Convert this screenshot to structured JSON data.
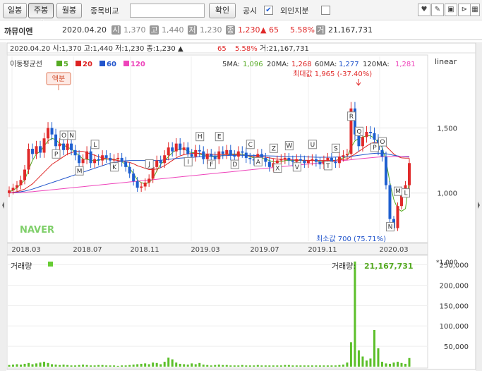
{
  "toolbar": {
    "btn_daily": "일봉",
    "btn_weekly": "주봉",
    "btn_monthly": "월봉",
    "compare_label": "종목비교",
    "confirm": "확인",
    "disclosure": "공시",
    "foreign": "외인지분",
    "disclosure_checked": "✔"
  },
  "info": {
    "name": "까뮤이앤",
    "date": "2020.04.20",
    "open_badge": "시",
    "open": "1,370",
    "high_badge": "고",
    "high": "1,440",
    "low_badge": "저",
    "low": "1,230",
    "close_badge": "종",
    "close": "1,230",
    "change": "▲ 65",
    "pct": "5.58%",
    "vol_badge": "거",
    "volume": "21,167,731"
  },
  "chart_data": [
    {
      "type": "candlestick",
      "ohlc_label": "2020.04.20  시:1,370  고:1,440  저:1,230  종:1,230 ▲",
      "change_label": "65",
      "pct_label": "5.58%",
      "vol_label": "거:21,167,731",
      "ma_legend_title": "이동평균선",
      "ma_legend": [
        {
          "name": "5",
          "color": "#55aa22"
        },
        {
          "name": "20",
          "color": "#dd2222"
        },
        {
          "name": "60",
          "color": "#2255cc"
        },
        {
          "name": "120",
          "color": "#ee44bb"
        }
      ],
      "ma_values": {
        "ma5_label": "5MA:",
        "ma5": "1,096",
        "ma20_label": "20MA:",
        "ma20": "1,268",
        "ma60_label": "60MA:",
        "ma60": "1,277",
        "ma120_label": "120MA:",
        "ma120": "1,281"
      },
      "scale": "linear",
      "max_label": "최대값 1,965 (-37.40%)",
      "min_label": "최소값 700 (75.71%)",
      "event_tag": "액분",
      "logo": "NAVER",
      "ylim": [
        630,
        2050
      ],
      "yticks": [
        1000,
        1500
      ],
      "ytick_labels": [
        "1,000",
        "1,500"
      ],
      "xtick_labels": [
        "2018.03",
        "2018.07",
        "2018.11",
        "2019.03",
        "2019.07",
        "2019.11",
        "2020.03"
      ],
      "closes": [
        1020,
        1040,
        1060,
        1100,
        1180,
        1340,
        1300,
        1360,
        1310,
        1420,
        1500,
        1450,
        1360,
        1380,
        1330,
        1380,
        1330,
        1290,
        1230,
        1260,
        1320,
        1230,
        1260,
        1250,
        1290,
        1270,
        1250,
        1260,
        1270,
        1240,
        1200,
        1150,
        1090,
        1040,
        1050,
        1080,
        1110,
        1200,
        1250,
        1230,
        1290,
        1350,
        1320,
        1380,
        1330,
        1350,
        1300,
        1280,
        1330,
        1320,
        1260,
        1300,
        1280,
        1260,
        1320,
        1300,
        1330,
        1290,
        1280,
        1320,
        1310,
        1270,
        1260,
        1250,
        1300,
        1270,
        1240,
        1200,
        1230,
        1250,
        1260,
        1270,
        1250,
        1240,
        1260,
        1250,
        1230,
        1250,
        1260,
        1240,
        1220,
        1250,
        1270,
        1240,
        1230,
        1280,
        1290,
        1300,
        1650,
        1450,
        1360,
        1430,
        1470,
        1460,
        1410,
        1330,
        1280,
        1060,
        800,
        730,
        900,
        1000,
        1060,
        1230
      ],
      "ma_series": {
        "ma5": [
          1010,
          1020,
          1040,
          1070,
          1100,
          1180,
          1250,
          1300,
          1320,
          1360,
          1400,
          1420,
          1410,
          1380,
          1370,
          1350,
          1340,
          1310,
          1290,
          1260,
          1260,
          1250,
          1250,
          1250,
          1260,
          1260,
          1260,
          1260,
          1250,
          1240,
          1220,
          1190,
          1150,
          1100,
          1080,
          1070,
          1080,
          1110,
          1170,
          1220,
          1250,
          1280,
          1310,
          1330,
          1340,
          1340,
          1320,
          1310,
          1310,
          1300,
          1290,
          1290,
          1280,
          1280,
          1280,
          1290,
          1300,
          1300,
          1300,
          1300,
          1300,
          1290,
          1280,
          1270,
          1270,
          1270,
          1260,
          1250,
          1240,
          1240,
          1240,
          1250,
          1250,
          1250,
          1250,
          1250,
          1250,
          1250,
          1250,
          1250,
          1240,
          1240,
          1240,
          1240,
          1250,
          1260,
          1270,
          1280,
          1350,
          1400,
          1420,
          1430,
          1440,
          1440,
          1420,
          1390,
          1350,
          1250,
          1080,
          950,
          880,
          860,
          880,
          1096
        ],
        "ma20": [
          1000,
          1005,
          1010,
          1020,
          1030,
          1050,
          1070,
          1100,
          1130,
          1160,
          1190,
          1220,
          1240,
          1260,
          1280,
          1300,
          1310,
          1320,
          1320,
          1320,
          1310,
          1300,
          1290,
          1280,
          1270,
          1265,
          1260,
          1255,
          1250,
          1245,
          1240,
          1235,
          1225,
          1210,
          1200,
          1190,
          1180,
          1180,
          1185,
          1195,
          1210,
          1230,
          1250,
          1270,
          1285,
          1295,
          1300,
          1305,
          1305,
          1305,
          1300,
          1300,
          1300,
          1295,
          1295,
          1295,
          1295,
          1295,
          1295,
          1295,
          1290,
          1290,
          1285,
          1280,
          1280,
          1280,
          1275,
          1270,
          1265,
          1260,
          1260,
          1258,
          1256,
          1255,
          1254,
          1253,
          1252,
          1251,
          1250,
          1250,
          1250,
          1250,
          1250,
          1250,
          1252,
          1255,
          1258,
          1262,
          1280,
          1300,
          1320,
          1340,
          1360,
          1380,
          1390,
          1390,
          1380,
          1360,
          1330,
          1300,
          1280,
          1270,
          1268,
          1268
        ],
        "ma60": [
          1000,
          1003,
          1006,
          1010,
          1015,
          1022,
          1030,
          1040,
          1050,
          1060,
          1070,
          1080,
          1090,
          1100,
          1110,
          1120,
          1130,
          1140,
          1150,
          1160,
          1170,
          1180,
          1190,
          1200,
          1210,
          1220,
          1230,
          1235,
          1240,
          1245,
          1248,
          1250,
          1250,
          1250,
          1250,
          1250,
          1250,
          1250,
          1250,
          1252,
          1255,
          1258,
          1262,
          1265,
          1268,
          1270,
          1272,
          1274,
          1276,
          1278,
          1280,
          1282,
          1284,
          1285,
          1286,
          1287,
          1288,
          1289,
          1290,
          1290,
          1290,
          1290,
          1290,
          1289,
          1288,
          1287,
          1286,
          1285,
          1284,
          1283,
          1282,
          1281,
          1280,
          1280,
          1280,
          1279,
          1278,
          1277,
          1276,
          1275,
          1275,
          1275,
          1275,
          1275,
          1276,
          1277,
          1278,
          1279,
          1282,
          1286,
          1290,
          1294,
          1298,
          1302,
          1305,
          1306,
          1305,
          1302,
          1296,
          1290,
          1285,
          1280,
          1278,
          1277
        ],
        "ma120": [
          1000,
          1001,
          1002,
          1004,
          1006,
          1008,
          1010,
          1013,
          1016,
          1019,
          1022,
          1025,
          1028,
          1031,
          1034,
          1037,
          1040,
          1043,
          1046,
          1049,
          1052,
          1055,
          1058,
          1061,
          1064,
          1067,
          1070,
          1073,
          1076,
          1079,
          1082,
          1085,
          1088,
          1091,
          1094,
          1097,
          1100,
          1103,
          1106,
          1109,
          1112,
          1115,
          1118,
          1121,
          1124,
          1127,
          1130,
          1133,
          1136,
          1139,
          1142,
          1145,
          1148,
          1151,
          1154,
          1157,
          1160,
          1163,
          1166,
          1169,
          1172,
          1175,
          1178,
          1181,
          1184,
          1187,
          1190,
          1193,
          1196,
          1199,
          1202,
          1205,
          1208,
          1211,
          1214,
          1217,
          1220,
          1223,
          1226,
          1229,
          1232,
          1235,
          1238,
          1241,
          1244,
          1247,
          1250,
          1253,
          1256,
          1259,
          1262,
          1265,
          1268,
          1271,
          1274,
          1276,
          1278,
          1279,
          1280,
          1281,
          1281,
          1281,
          1281,
          1281
        ]
      },
      "events": [
        {
          "label": "O",
          "i": 14
        },
        {
          "label": "P",
          "i": 12
        },
        {
          "label": "N",
          "i": 16
        },
        {
          "label": "M",
          "i": 18
        },
        {
          "label": "L",
          "i": 22
        },
        {
          "label": "K",
          "i": 27
        },
        {
          "label": "J",
          "i": 36
        },
        {
          "label": "I",
          "i": 46
        },
        {
          "label": "H",
          "i": 49
        },
        {
          "label": "F",
          "i": 52
        },
        {
          "label": "E",
          "i": 54
        },
        {
          "label": "D",
          "i": 58
        },
        {
          "label": "C",
          "i": 62
        },
        {
          "label": "A",
          "i": 64
        },
        {
          "label": "Z",
          "i": 68
        },
        {
          "label": "X",
          "i": 69
        },
        {
          "label": "W",
          "i": 72
        },
        {
          "label": "V",
          "i": 74
        },
        {
          "label": "U",
          "i": 78
        },
        {
          "label": "T",
          "i": 82
        },
        {
          "label": "S",
          "i": 84
        },
        {
          "label": "R",
          "i": 88
        },
        {
          "label": "Q",
          "i": 90
        },
        {
          "label": "P",
          "i": 94
        },
        {
          "label": "O",
          "i": 96
        },
        {
          "label": "N",
          "i": 98
        },
        {
          "label": "M",
          "i": 100
        },
        {
          "label": "L",
          "i": 102
        }
      ]
    },
    {
      "type": "bar",
      "title": "거래량",
      "legend_label": "거래량:",
      "legend_value": "21,167,731",
      "unit": "*1,000",
      "ylim": [
        0,
        270000
      ],
      "yticks": [
        50000,
        100000,
        150000,
        200000,
        250000
      ],
      "ytick_labels": [
        "50,000",
        "100,000",
        "150,000",
        "200,000",
        "250,000"
      ],
      "values": [
        4000,
        5000,
        6000,
        5000,
        7000,
        9000,
        6000,
        8000,
        10000,
        12000,
        9000,
        6000,
        5000,
        4000,
        5000,
        4000,
        3000,
        3000,
        4000,
        5000,
        4000,
        3000,
        3000,
        4000,
        4000,
        3000,
        3000,
        3000,
        2000,
        3000,
        3000,
        4000,
        5000,
        6000,
        7000,
        8000,
        6000,
        10000,
        9000,
        6000,
        12000,
        22000,
        18000,
        10000,
        7000,
        6000,
        5000,
        8000,
        6000,
        9000,
        5000,
        4000,
        3000,
        4000,
        5000,
        4000,
        4000,
        3000,
        3000,
        3000,
        4000,
        3000,
        3000,
        3000,
        4000,
        3000,
        3000,
        3000,
        3000,
        3000,
        3000,
        4000,
        4000,
        3000,
        3000,
        3000,
        3000,
        3000,
        3000,
        3000,
        3000,
        3000,
        3000,
        3000,
        3000,
        4000,
        5000,
        10000,
        60000,
        258000,
        40000,
        25000,
        15000,
        20000,
        90000,
        45000,
        12000,
        8000,
        7000,
        10000,
        12000,
        9000,
        7000,
        21168
      ]
    }
  ],
  "view_options": {
    "grid": true,
    "legend_position": "top-left"
  }
}
